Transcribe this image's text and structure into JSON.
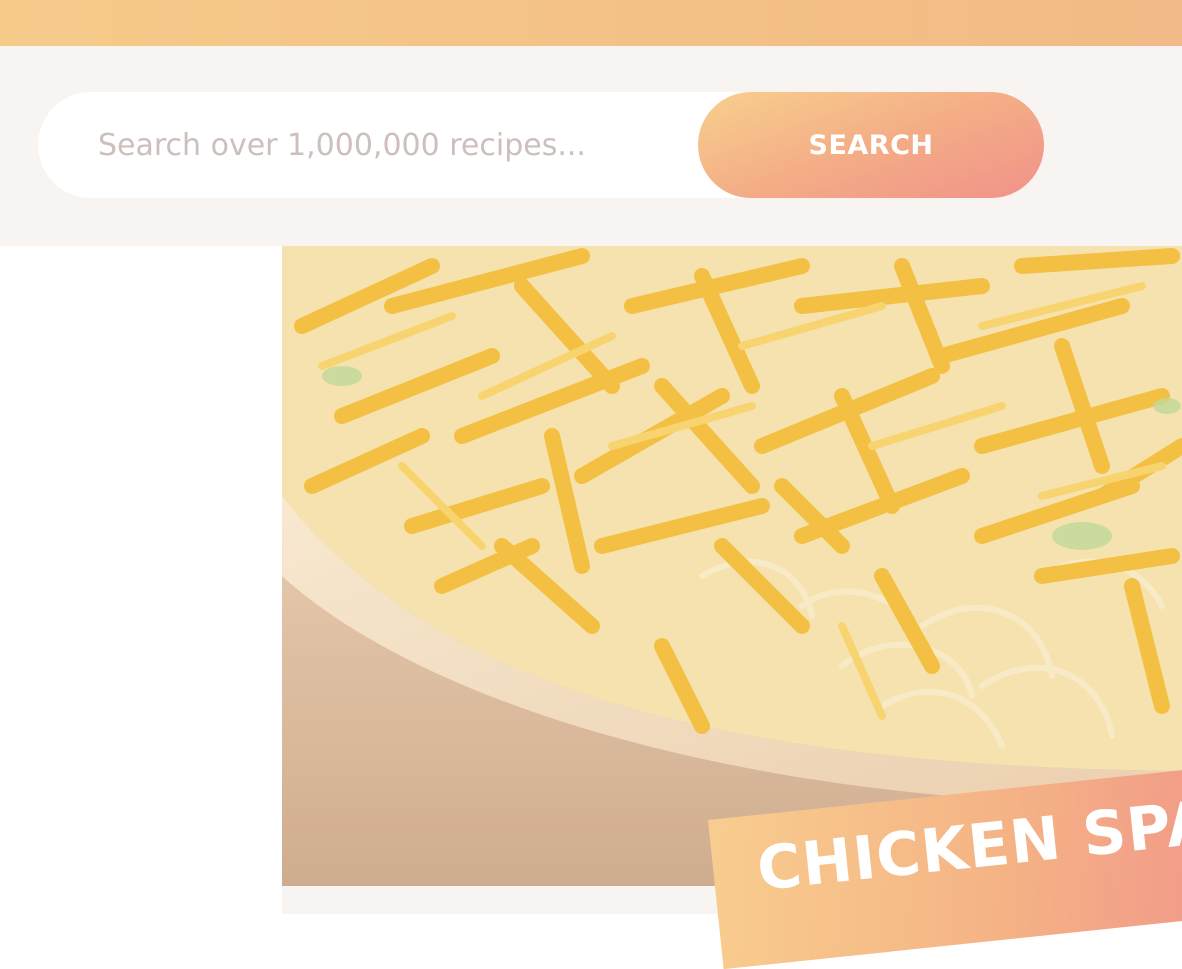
{
  "search": {
    "placeholder": "Search over 1,000,000 recipes...",
    "button_label": "SEARCH"
  },
  "recipe": {
    "title": "CHICKEN SPA",
    "image_icon": "recipe-photo"
  },
  "colors": {
    "top_bar": "#f3c085",
    "band": "#f8f4f1",
    "accent_start": "#f8d08e",
    "accent_end": "#f1928a"
  }
}
